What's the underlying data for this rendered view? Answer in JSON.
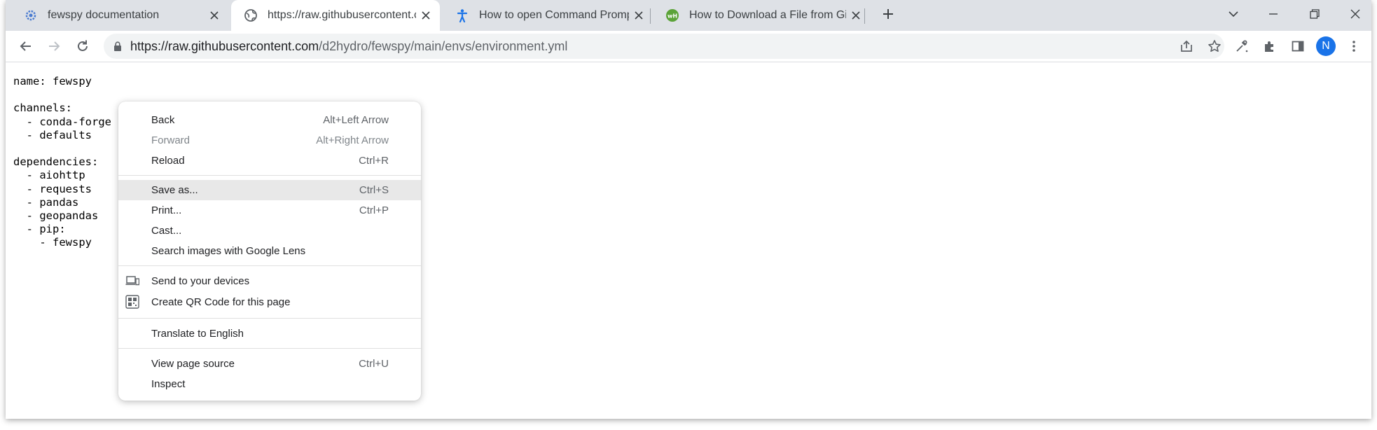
{
  "tabs": [
    {
      "title": "fewspy documentation",
      "favicon": "gear-cog-icon",
      "active": false
    },
    {
      "title": "https://raw.githubusercontent.co",
      "favicon": "globe-icon",
      "active": true
    },
    {
      "title": "How to open Command Prompt",
      "favicon": "person-accessibility-icon",
      "active": false
    },
    {
      "title": "How to Download a File from Git",
      "favicon": "wh-logo-icon",
      "active": false
    }
  ],
  "url": {
    "host": "https://raw.githubusercontent.com",
    "path": "/d2hydro/fewspy/main/envs/environment.yml"
  },
  "profile": {
    "initial": "N",
    "color": "#1a73e8"
  },
  "yaml_text": "name: fewspy\n\nchannels:\n  - conda-forge\n  - defaults\n\ndependencies:\n  - aiohttp\n  - requests\n  - pandas\n  - geopandas\n  - pip:\n    - fewspy",
  "context_menu": {
    "items": [
      {
        "label": "Back",
        "shortcut": "Alt+Left Arrow"
      },
      {
        "label": "Forward",
        "shortcut": "Alt+Right Arrow",
        "disabled": true
      },
      {
        "label": "Reload",
        "shortcut": "Ctrl+R"
      },
      {
        "label": "Save as...",
        "shortcut": "Ctrl+S",
        "highlighted": true
      },
      {
        "label": "Print...",
        "shortcut": "Ctrl+P"
      },
      {
        "label": "Cast...",
        "shortcut": ""
      },
      {
        "label": "Search images with Google Lens",
        "shortcut": ""
      },
      {
        "label": "Send to your devices",
        "shortcut": "",
        "icon": "devices-icon"
      },
      {
        "label": "Create QR Code for this page",
        "shortcut": "",
        "icon": "qr-code-icon"
      },
      {
        "label": "Translate to English",
        "shortcut": ""
      },
      {
        "label": "View page source",
        "shortcut": "Ctrl+U"
      },
      {
        "label": "Inspect",
        "shortcut": ""
      }
    ]
  }
}
